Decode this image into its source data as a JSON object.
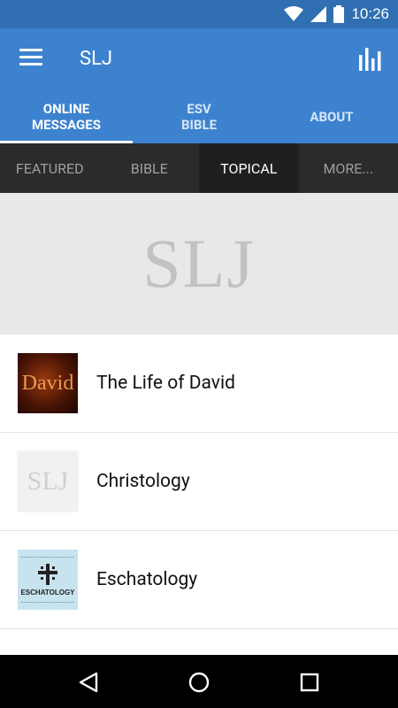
{
  "status": {
    "time": "10:26"
  },
  "app": {
    "title": "SLJ"
  },
  "tabs": [
    {
      "line1": "ONLINE",
      "line2": "MESSAGES"
    },
    {
      "line1": "ESV",
      "line2": "BIBLE"
    },
    {
      "line1": "ABOUT",
      "line2": ""
    }
  ],
  "subtabs": [
    "FEATURED",
    "BIBLE",
    "TOPICAL",
    "MORE..."
  ],
  "banner": {
    "logo": "SLJ"
  },
  "items": [
    {
      "title": "The Life of David",
      "thumb_text": "David"
    },
    {
      "title": "Christology",
      "thumb_text": "SLJ"
    },
    {
      "title": "Eschatology",
      "thumb_text": "ESCHATOLOGY"
    }
  ],
  "colors": {
    "appbar": "#3d82cf",
    "statusbar": "#2f6fb2",
    "subtabs": "#2b2b2b"
  }
}
